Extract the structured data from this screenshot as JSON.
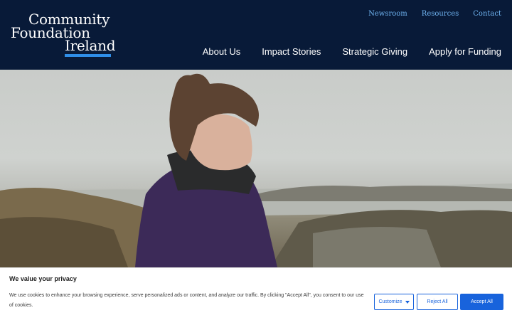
{
  "brand": {
    "logo_line1": "Community",
    "logo_line2": "Foundation",
    "logo_line3": "Ireland",
    "accent_color": "#2f8ee8",
    "header_bg": "#081a38"
  },
  "utility_nav": {
    "items": [
      {
        "label": "Newsroom"
      },
      {
        "label": "Resources"
      },
      {
        "label": "Contact"
      }
    ]
  },
  "main_nav": {
    "items": [
      {
        "label": "About Us"
      },
      {
        "label": "Impact Stories"
      },
      {
        "label": "Strategic Giving"
      },
      {
        "label": "Apply for Funding"
      }
    ]
  },
  "cookie_banner": {
    "title": "We value your privacy",
    "text": "We use cookies to enhance your browsing experience, serve personalized ads or content, and analyze our traffic. By clicking \"Accept All\", you consent to our use of cookies.",
    "customize_label": "Customize",
    "reject_label": "Reject All",
    "accept_label": "Accept All",
    "button_color": "#1863dc"
  }
}
